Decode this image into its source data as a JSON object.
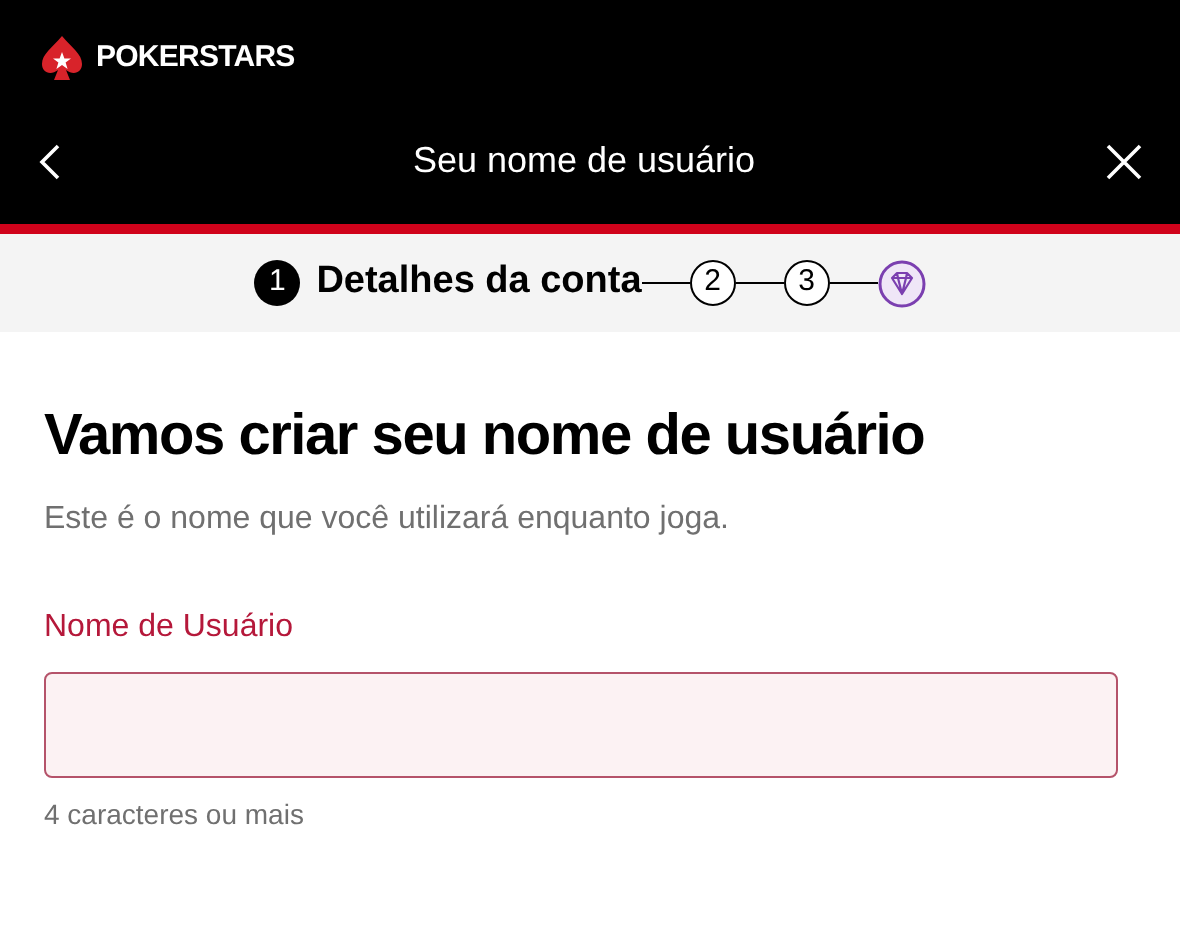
{
  "brand": {
    "name": "POKERSTARS"
  },
  "nav": {
    "title": "Seu nome de usuário"
  },
  "steps": [
    {
      "kind": "number",
      "number": "1",
      "label": "Detalhes da conta",
      "selected": true
    },
    {
      "kind": "number",
      "number": "2",
      "selected": false
    },
    {
      "kind": "number",
      "number": "3",
      "selected": false
    },
    {
      "kind": "diamond",
      "selected": false
    }
  ],
  "heading": "Vamos criar seu nome de usuário",
  "subtitle": "Este é o nome que você utilizará enquanto joga.",
  "field": {
    "label": "Nome de Usuário",
    "hint": "4 caracteres ou mais",
    "error": true
  }
}
